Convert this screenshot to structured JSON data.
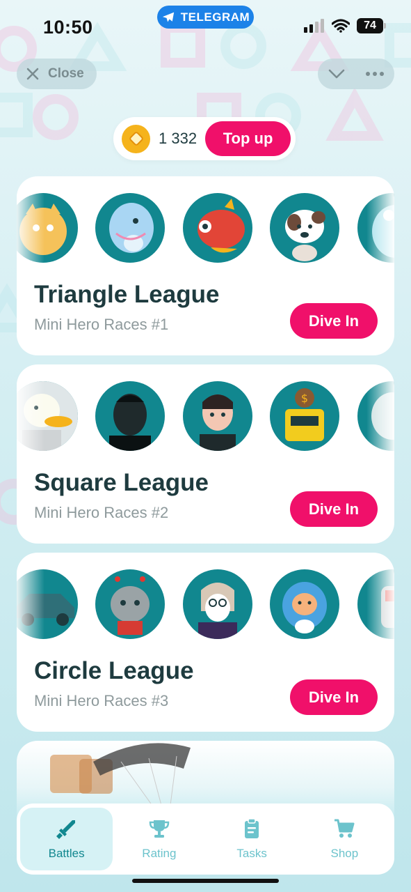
{
  "status_bar": {
    "time": "10:50",
    "app_pill": "TELEGRAM",
    "battery": "74"
  },
  "header": {
    "close_label": "Close"
  },
  "balance": {
    "amount": "1 332",
    "top_up_label": "Top up"
  },
  "leagues": [
    {
      "title": "Triangle League",
      "subtitle": "Mini Hero Races #1",
      "button": "Dive In"
    },
    {
      "title": "Square League",
      "subtitle": "Mini Hero Races #2",
      "button": "Dive In"
    },
    {
      "title": "Circle League",
      "subtitle": "Mini Hero Races #3",
      "button": "Dive In"
    }
  ],
  "nav": [
    {
      "label": "Battles",
      "icon": "sword-icon",
      "active": true
    },
    {
      "label": "Rating",
      "icon": "trophy-icon",
      "active": false
    },
    {
      "label": "Tasks",
      "icon": "clipboard-icon",
      "active": false
    },
    {
      "label": "Shop",
      "icon": "cart-icon",
      "active": false
    }
  ],
  "colors": {
    "accent": "#f0106a",
    "teal": "#11878f",
    "telegram": "#1c82e8"
  }
}
